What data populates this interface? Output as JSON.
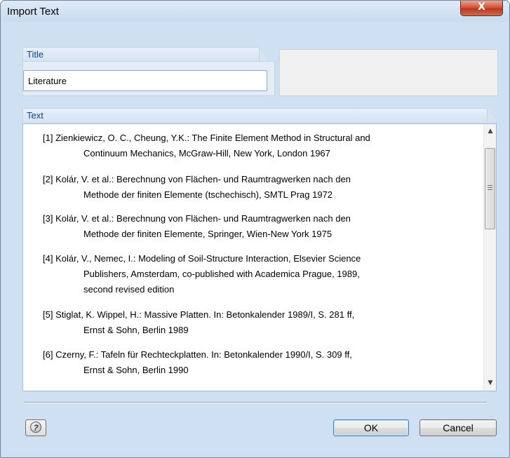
{
  "window": {
    "title": "Import Text",
    "close_glyph": "X"
  },
  "title_group": {
    "label": "Title",
    "value": "Literature"
  },
  "text_group": {
    "label": "Text",
    "references": [
      {
        "lines": [
          "[1] Zienkiewicz, O. C., Cheung, Y.K.: The Finite Element Method in Structural and",
          "Continuum Mechanics, McGraw-Hill, New York, London 1967"
        ]
      },
      {
        "lines": [
          "[2] Kolár, V. et al.: Berechnung von Flächen- und Raumtragwerken nach den",
          "Methode der finiten Elemente (tschechisch), SMTL Prag 1972"
        ]
      },
      {
        "lines": [
          "[3] Kolár, V. et al.: Berechnung von Flächen- und Raumtragwerken nach den",
          "Methode der finiten Elemente, Springer, Wien-New York 1975"
        ]
      },
      {
        "lines": [
          "[4] Kolár, V., Nemec, I.: Modeling of Soil-Structure Interaction, Elsevier Science",
          "Publishers, Amsterdam, co-published with Academica Prague, 1989,",
          "second revised edition"
        ]
      },
      {
        "lines": [
          "[5] Stiglat, K. Wippel, H.: Massive Platten. In: Betonkalender 1989/I, S. 281 ff,",
          "Ernst & Sohn, Berlin 1989"
        ]
      },
      {
        "lines": [
          "[6] Czerny, F.: Tafeln für Rechteckplatten. In: Betonkalender 1990/I, S. 309 ff,",
          "Ernst & Sohn, Berlin 1990"
        ]
      }
    ]
  },
  "scrollbar": {
    "up_icon": "scroll-up-arrow",
    "down_icon": "scroll-down-arrow",
    "up_glyph": "▲",
    "down_glyph": "▼"
  },
  "buttons": {
    "help_glyph": "?",
    "ok_label": "OK",
    "cancel_label": "Cancel"
  },
  "colors": {
    "accent_label": "#15428b",
    "close_button": "#c9482d",
    "group_header": "#d6e3f3"
  }
}
